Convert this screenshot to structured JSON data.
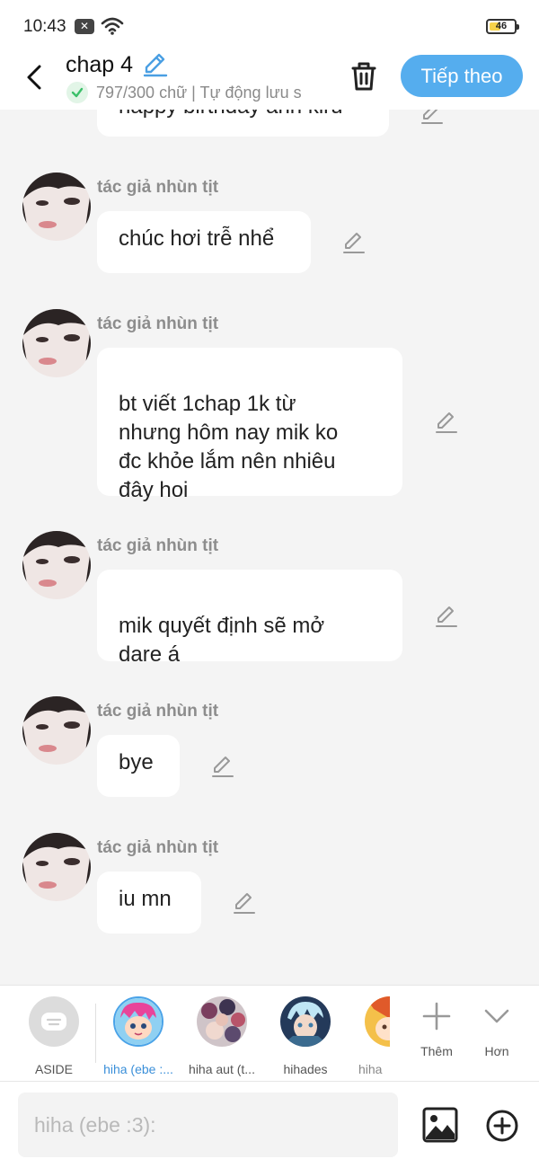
{
  "status_bar": {
    "time": "10:43",
    "notification_badge": "✕",
    "battery_level": "46",
    "battery_fraction": 0.46
  },
  "header": {
    "title": "chap 4",
    "word_count": "797/300 chữ | Tự động lưu s",
    "next_label": "Tiếp theo"
  },
  "chat": {
    "partial_message": "happy birthday anh kiru",
    "messages": [
      {
        "author": "tác giả nhùn tịt",
        "text": "chúc hơi trễ nhể"
      },
      {
        "author": "tác giả nhùn tịt",
        "text": "bt viết 1chap 1k từ\nnhưng hôm nay mik ko\nđc khỏe lắm nên nhiêu\nđây hoi"
      },
      {
        "author": "tác giả nhùn tịt",
        "text": "mik quyết định sẽ mở\ndare á"
      },
      {
        "author": "tác giả nhùn tịt",
        "text": "bye"
      },
      {
        "author": "tác giả nhùn tịt",
        "text": "iu mn"
      }
    ]
  },
  "character_bar": {
    "aside_label": "ASIDE",
    "characters": [
      {
        "name": "hiha (ebe :...",
        "selected": true
      },
      {
        "name": "hiha aut (t...",
        "selected": false
      },
      {
        "name": "hihades",
        "selected": false
      },
      {
        "name": "hiha",
        "selected": false
      }
    ],
    "add_label": "Thêm",
    "more_label": "Hơn"
  },
  "input_bar": {
    "placeholder": "hiha (ebe :3):"
  },
  "colors": {
    "accent": "#55adee",
    "selected_character_name": "#3a8fd9",
    "background": "#f4f4f4",
    "bubble": "#ffffff",
    "meta_text": "#8d8d8d"
  }
}
